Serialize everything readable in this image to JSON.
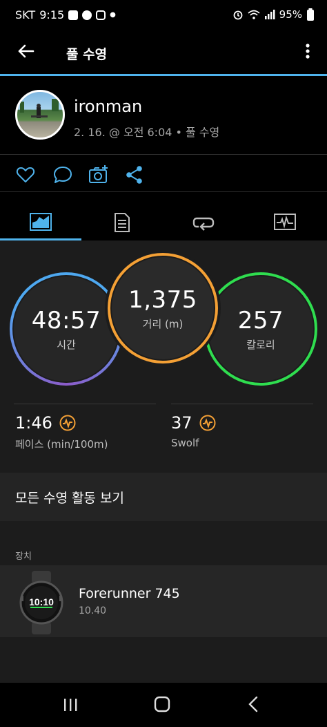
{
  "status_bar": {
    "carrier": "SKT",
    "time": "9:15",
    "battery": "95%"
  },
  "toolbar": {
    "title": "풀 수영"
  },
  "profile": {
    "username": "ironman",
    "meta": "2. 16. @ 오전 6:04 • 풀 수영"
  },
  "tabs": [
    {
      "name": "summary",
      "icon": "chart-icon",
      "selected": true
    },
    {
      "name": "details",
      "icon": "document-icon",
      "selected": false
    },
    {
      "name": "laps",
      "icon": "loop-icon",
      "selected": false
    },
    {
      "name": "charts",
      "icon": "heart-monitor-icon",
      "selected": false
    }
  ],
  "stats": {
    "time": {
      "value": "48:57",
      "label": "시간"
    },
    "distance": {
      "value": "1,375",
      "label": "거리 (m)"
    },
    "calories": {
      "value": "257",
      "label": "칼로리"
    },
    "pace": {
      "value": "1:46",
      "label": "페이스 (min/100m)"
    },
    "swolf": {
      "value": "37",
      "label": "Swolf"
    }
  },
  "colors": {
    "accent_blue": "#4fb3ec",
    "distance_ring": "#f4a035",
    "calories_ring": "#2fdd4f",
    "time_ring_top": "#4ea8f0",
    "time_ring_bottom": "#8c5cc9"
  },
  "all_activities": {
    "label": "모든 수영 활동 보기"
  },
  "device_section": {
    "label": "장치",
    "name": "Forerunner 745",
    "version": "10.40",
    "watch_face_time": "10:10"
  }
}
